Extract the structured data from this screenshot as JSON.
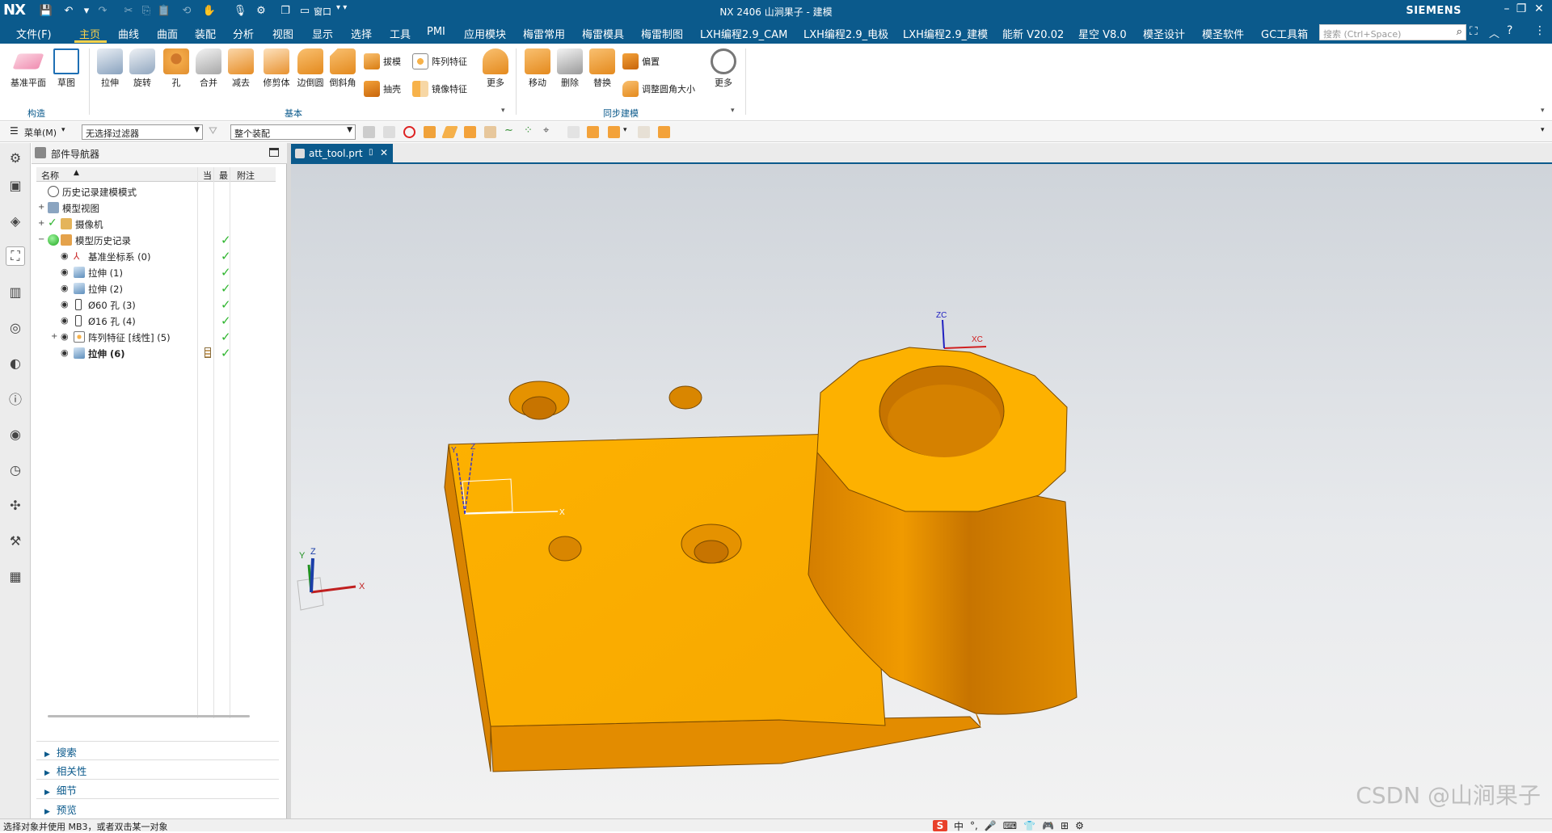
{
  "app": {
    "logo": "NX",
    "title": "NX 2406 山涧果子 - 建模",
    "brand": "SIEMENS",
    "window_menu": "窗口",
    "accent_color": "#0b5a8c",
    "model_color": "#f5a600"
  },
  "menubar": {
    "items": [
      "文件(F)",
      "主页",
      "曲线",
      "曲面",
      "装配",
      "分析",
      "视图",
      "显示",
      "选择",
      "工具",
      "PMI",
      "应用模块",
      "梅雷常用",
      "梅雷模具",
      "梅雷制图",
      "LXH编程2.9_CAM",
      "LXH编程2.9_电极",
      "LXH编程2.9_建模",
      "能新 V20.02",
      "星空 V8.0",
      "模圣设计",
      "模圣软件",
      "GC工具箱"
    ],
    "active": "主页",
    "search_placeholder": "搜索 (Ctrl+Space)"
  },
  "ribbon": {
    "groups": {
      "construct": "构造",
      "basic": "基本",
      "sync": "同步建模"
    },
    "construct_buttons": [
      "基准平面",
      "草图"
    ],
    "basic_buttons": [
      "拉伸",
      "旋转",
      "孔",
      "合并",
      "减去",
      "修剪体",
      "边倒圆",
      "倒斜角"
    ],
    "basic_small": [
      "拔模",
      "阵列特征",
      "抽壳",
      "镜像特征"
    ],
    "basic_more": "更多",
    "sync_buttons": [
      "移动",
      "删除",
      "替换"
    ],
    "sync_small": [
      "偏置",
      "调整圆角大小"
    ],
    "sync_more": "更多"
  },
  "toolbar2": {
    "menu_label": "菜单(M)",
    "filter_value": "无选择过滤器",
    "scope_value": "整个装配"
  },
  "navigator": {
    "title": "部件导航器",
    "columns": {
      "name": "名称",
      "current": "当",
      "latest": "最",
      "note": "附注"
    },
    "rows": [
      {
        "label": "历史记录建模模式",
        "level": 0,
        "check": false
      },
      {
        "label": "模型视图",
        "level": 0,
        "check": false
      },
      {
        "label": "摄像机",
        "level": 0,
        "check": false
      },
      {
        "label": "模型历史记录",
        "level": 0,
        "check": true
      },
      {
        "label": "基准坐标系 (0)",
        "level": 1,
        "check": true
      },
      {
        "label": "拉伸 (1)",
        "level": 1,
        "check": true
      },
      {
        "label": "拉伸 (2)",
        "level": 1,
        "check": true
      },
      {
        "label": "Ø60 孔 (3)",
        "level": 1,
        "check": true
      },
      {
        "label": "Ø16 孔 (4)",
        "level": 1,
        "check": true
      },
      {
        "label": "阵列特征 [线性] (5)",
        "level": 1,
        "check": true
      },
      {
        "label": "拉伸 (6)",
        "level": 1,
        "check": true
      }
    ],
    "sections": [
      "搜索",
      "相关性",
      "细节",
      "预览"
    ]
  },
  "document": {
    "tab": "att_tool.prt"
  },
  "viewport": {
    "watermark": "CSDN @山涧果子",
    "triad_labels": {
      "x": "X",
      "y": "Y",
      "z": "Z",
      "xc": "XC",
      "zc": "ZC"
    }
  },
  "status": {
    "message": "选择对象并使用 MB3，或者双击某一对象",
    "ime": [
      "中",
      "°,",
      "🎤",
      "⌨",
      "👕",
      "🎮",
      "⊞",
      "⚙"
    ]
  }
}
